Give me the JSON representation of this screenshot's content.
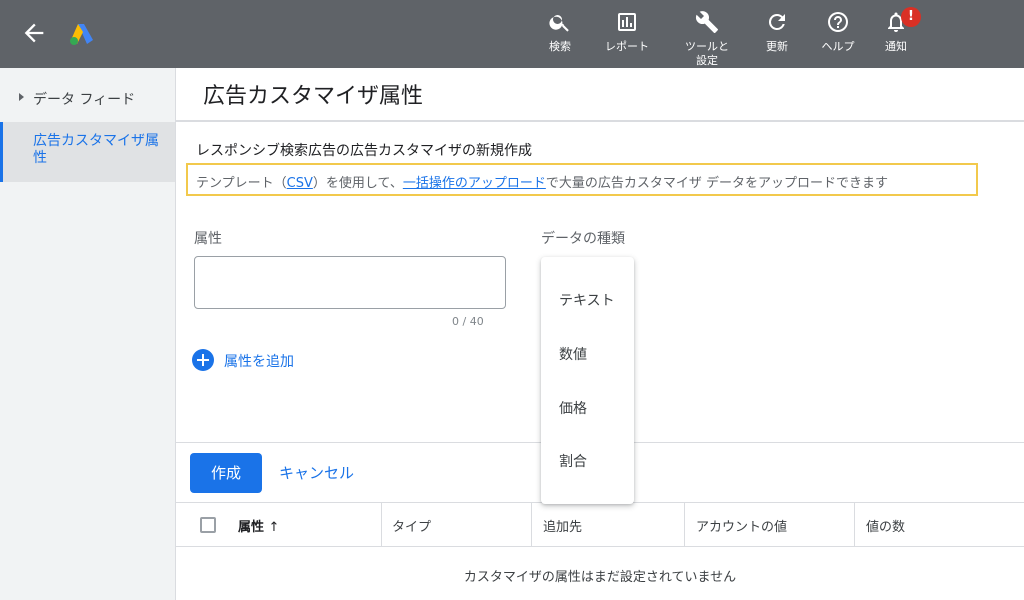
{
  "topbar": {
    "items": [
      {
        "label": "検索",
        "icon": "search-icon"
      },
      {
        "label": "レポート",
        "icon": "report-icon"
      },
      {
        "label": "ツールと設定",
        "icon": "wrench-icon"
      },
      {
        "label": "更新",
        "icon": "refresh-icon"
      },
      {
        "label": "ヘルプ",
        "icon": "help-icon"
      },
      {
        "label": "通知",
        "icon": "bell-icon"
      }
    ],
    "notification_badge": "!"
  },
  "sidebar": {
    "items": [
      {
        "label": "データ フィード"
      },
      {
        "label": "広告カスタマイザ属性"
      }
    ]
  },
  "page": {
    "title": "広告カスタマイザ属性",
    "section_title": "レスポンシブ検索広告の広告カスタマイザの新規作成",
    "info": {
      "prefix": "テンプレート（",
      "csv_link": "CSV",
      "middle": "）を使用して、",
      "bulk_link": "一括操作のアップロード",
      "suffix": "で大量の広告カスタマイザ データをアップロードできます"
    }
  },
  "form": {
    "attribute_label": "属性",
    "attribute_value": "",
    "char_count": "0 / 40",
    "data_type_label": "データの種類",
    "data_type_options": [
      "テキスト",
      "数値",
      "価格",
      "割合"
    ],
    "add_attribute": "属性を追加"
  },
  "actions": {
    "create": "作成",
    "cancel": "キャンセル"
  },
  "table": {
    "columns": [
      "属性",
      "タイプ",
      "追加先",
      "アカウントの値",
      "値の数"
    ],
    "sort_indicator": "↑",
    "empty_message": "カスタマイザの属性はまだ設定されていません"
  },
  "colors": {
    "accent": "#1a73e8",
    "topbar": "#5f6368",
    "highlight_border": "#f2c94c",
    "badge": "#d93025"
  }
}
